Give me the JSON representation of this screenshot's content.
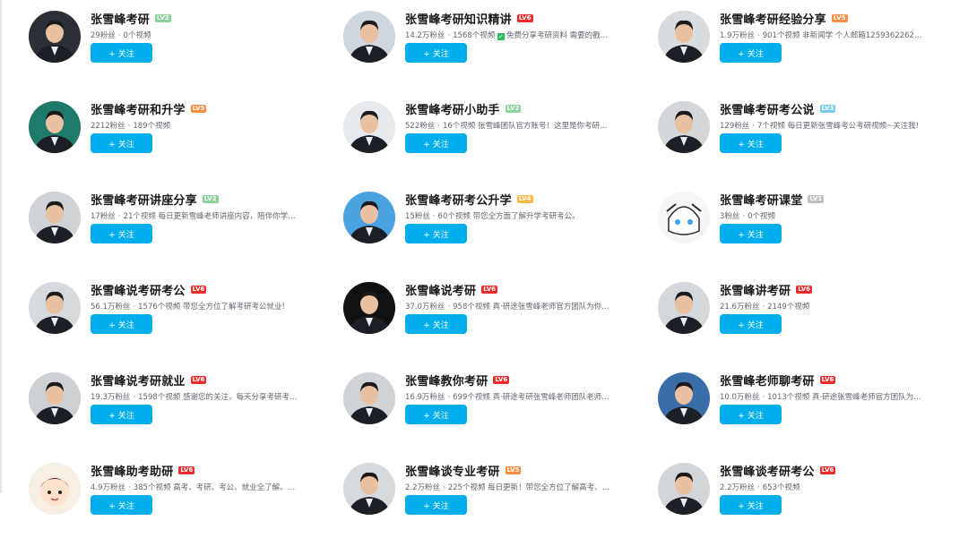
{
  "colors": {
    "accent": "#00aeec",
    "text": "#18191c",
    "meta": "#61666d"
  },
  "follow_label": "+ 关注",
  "creators": [
    {
      "name": "张雪峰考研",
      "level": "LV2",
      "level_color": "#8bd29b",
      "fans": "29粉丝",
      "videos": "0个视频",
      "desc": "",
      "verified": false,
      "avatar_icon": "person-avatar-icon"
    },
    {
      "name": "张雪峰考研知识精讲",
      "level": "LV6",
      "level_color": "#ee2b2b",
      "fans": "14.2万粉丝",
      "videos": "1568个视频",
      "desc": "免费分享考研资料 需要的戳我哦...",
      "verified": true,
      "avatar_icon": "person-avatar-icon"
    },
    {
      "name": "张雪峰考研经验分享",
      "level": "LV5",
      "level_color": "#ff8c3f",
      "fans": "1.9万粉丝",
      "videos": "901个视频",
      "desc": "非新闻学 个人邮箱1259362262@qq.c...",
      "verified": false,
      "avatar_icon": "person-avatar-icon"
    },
    {
      "name": "张雪峰考研和升学",
      "level": "LV5",
      "level_color": "#ff8c3f",
      "fans": "2212粉丝",
      "videos": "189个视频",
      "desc": "",
      "verified": false,
      "avatar_icon": "person-avatar-icon"
    },
    {
      "name": "张雪峰考研小助手",
      "level": "LV2",
      "level_color": "#8bd29b",
      "fans": "522粉丝",
      "videos": "16个视频",
      "desc": "张雪峰团队官方账号！这里是你考研学习...",
      "verified": false,
      "avatar_icon": "person-avatar-icon"
    },
    {
      "name": "张雪峰考研考公说",
      "level": "LV3",
      "level_color": "#7bcdef",
      "fans": "129粉丝",
      "videos": "7个视频",
      "desc": "每日更新张雪峰考公考研视频~关注我!",
      "verified": false,
      "avatar_icon": "person-avatar-icon"
    },
    {
      "name": "张雪峰考研讲座分享",
      "level": "LV2",
      "level_color": "#8bd29b",
      "fans": "17粉丝",
      "videos": "21个视频",
      "desc": "每日更新雪峰老师讲座内容，陪伴你学习...",
      "verified": false,
      "avatar_icon": "person-avatar-icon"
    },
    {
      "name": "张雪峰考研考公升学",
      "level": "LV4",
      "level_color": "#feb945",
      "fans": "15粉丝",
      "videos": "60个视频",
      "desc": "带您全方面了解升学考研考公。",
      "verified": false,
      "avatar_icon": "person-avatar-icon"
    },
    {
      "name": "张雪峰考研课堂",
      "level": "LV1",
      "level_color": "#c0c0c0",
      "fans": "3粉丝",
      "videos": "0个视频",
      "desc": "",
      "verified": false,
      "avatar_icon": "anime-avatar-icon"
    },
    {
      "name": "张雪峰说考研考公",
      "level": "LV6",
      "level_color": "#ee2b2b",
      "fans": "56.1万粉丝",
      "videos": "1576个视频",
      "desc": "带您全方位了解考研考公就业!",
      "verified": false,
      "avatar_icon": "person-avatar-icon"
    },
    {
      "name": "张雪峰说考研",
      "level": "LV6",
      "level_color": "#ee2b2b",
      "fans": "37.0万粉丝",
      "videos": "958个视频",
      "desc": "真·研途张雪峰老师官方团队为你答...",
      "verified": false,
      "avatar_icon": "person-avatar-icon"
    },
    {
      "name": "张雪峰讲考研",
      "level": "LV6",
      "level_color": "#ee2b2b",
      "fans": "21.6万粉丝",
      "videos": "2149个视频",
      "desc": "",
      "verified": false,
      "avatar_icon": "person-avatar-icon"
    },
    {
      "name": "张雪峰说考研就业",
      "level": "LV6",
      "level_color": "#ee2b2b",
      "fans": "19.3万粉丝",
      "videos": "1598个视频",
      "desc": "感谢您的关注，每天分享考研考公...",
      "verified": false,
      "avatar_icon": "person-avatar-icon"
    },
    {
      "name": "张雪峰教你考研",
      "level": "LV6",
      "level_color": "#ee2b2b",
      "fans": "16.9万粉丝",
      "videos": "699个视频",
      "desc": "真·研途考研张雪峰老师团队老师帮...",
      "verified": false,
      "avatar_icon": "person-avatar-icon"
    },
    {
      "name": "张雪峰老师聊考研",
      "level": "LV6",
      "level_color": "#ee2b2b",
      "fans": "10.0万粉丝",
      "videos": "1013个视频",
      "desc": "真·研途张雪峰老师官方团队为你答...",
      "verified": false,
      "avatar_icon": "person-avatar-icon"
    },
    {
      "name": "张雪峰助考助研",
      "level": "LV6",
      "level_color": "#ee2b2b",
      "fans": "4.9万粉丝",
      "videos": "385个视频",
      "desc": "高考、考研、考公、就业全了解。点个...",
      "verified": false,
      "avatar_icon": "cartoon-avatar-icon"
    },
    {
      "name": "张雪峰谈专业考研",
      "level": "LV5",
      "level_color": "#ff8c3f",
      "fans": "2.2万粉丝",
      "videos": "225个视频",
      "desc": "每日更新！带您全方位了解高考、考研...",
      "verified": false,
      "avatar_icon": "person-avatar-icon"
    },
    {
      "name": "张雪峰谈考研考公",
      "level": "LV6",
      "level_color": "#ee2b2b",
      "fans": "2.2万粉丝",
      "videos": "653个视频",
      "desc": "",
      "verified": false,
      "avatar_icon": "person-avatar-icon"
    }
  ]
}
